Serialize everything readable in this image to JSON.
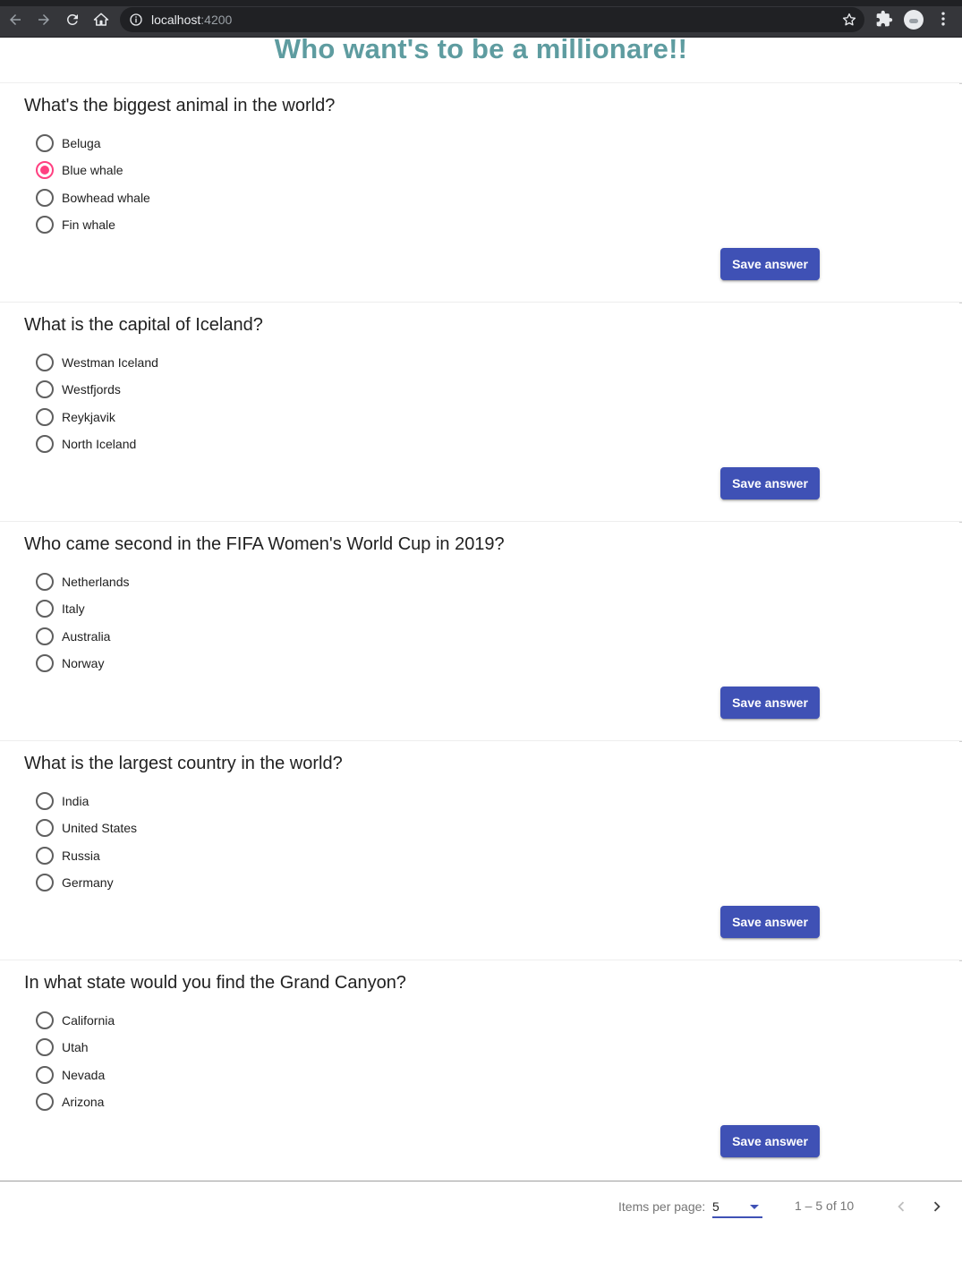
{
  "browser": {
    "url_host": "localhost",
    "url_port": ":4200"
  },
  "page": {
    "title": "Who want's to be a millionare!!",
    "title_color": "#5e9ca0"
  },
  "questions": [
    {
      "text": "What's the biggest animal in the world?",
      "options": [
        "Beluga",
        "Blue whale",
        "Bowhead whale",
        "Fin whale"
      ],
      "selected": 1,
      "save_label": "Save answer"
    },
    {
      "text": "What is the capital of Iceland?",
      "options": [
        "Westman Iceland",
        "Westfjords",
        "Reykjavik",
        "North Iceland"
      ],
      "selected": null,
      "save_label": "Save answer"
    },
    {
      "text": "Who came second in the FIFA Women's World Cup in 2019?",
      "options": [
        "Netherlands",
        "Italy",
        "Australia",
        "Norway"
      ],
      "selected": null,
      "save_label": "Save answer"
    },
    {
      "text": "What is the largest country in the world?",
      "options": [
        "India",
        "United States",
        "Russia",
        "Germany"
      ],
      "selected": null,
      "save_label": "Save answer"
    },
    {
      "text": "In what state would you find the Grand Canyon?",
      "options": [
        "California",
        "Utah",
        "Nevada",
        "Arizona"
      ],
      "selected": null,
      "save_label": "Save answer"
    }
  ],
  "paginator": {
    "items_per_page_label": "Items per page:",
    "page_size": "5",
    "range": "1 – 5 of 10"
  },
  "colors": {
    "primary": "#3f51b5",
    "accent": "#ff4081"
  }
}
